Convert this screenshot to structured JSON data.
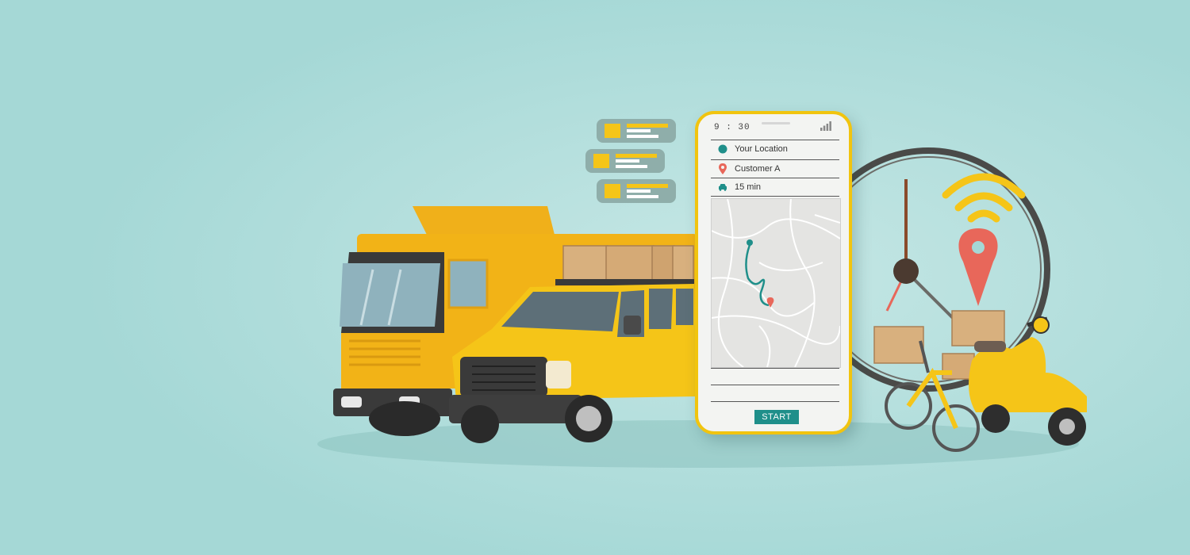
{
  "phone": {
    "status_time": "9 : 30",
    "rows": [
      {
        "icon": "dot-icon",
        "label": "Your Location"
      },
      {
        "icon": "location-pin-icon",
        "label": "Customer A"
      },
      {
        "icon": "car-icon",
        "label": "15 min"
      }
    ],
    "start_label": "START"
  },
  "colors": {
    "background": "#a5d8d6",
    "accent_yellow": "#f5c518",
    "teal": "#1f8f8a",
    "pin_red": "#e8675a"
  }
}
